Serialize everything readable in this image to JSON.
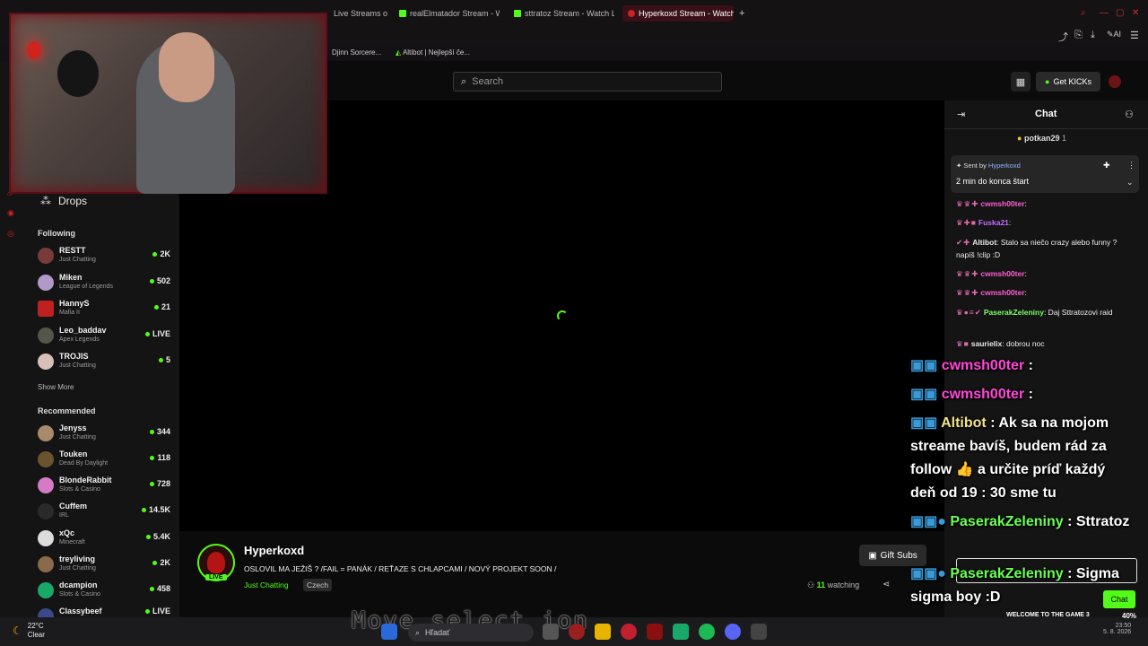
{
  "browser": {
    "tabs": [
      {
        "label": "Live Streams o"
      },
      {
        "label": "realElmatador Stream - W"
      },
      {
        "label": "sttratoz Stream - Watch Li"
      },
      {
        "label": "Hyperkoxd Stream - Watch"
      }
    ],
    "new_tab": "+",
    "toolbar_ai": "AI",
    "bookmarks": [
      "Djinn Sorcere...",
      "Altibot | Nejlepší če..."
    ]
  },
  "header": {
    "search_placeholder": "Search",
    "get_kicks": "Get KICKs"
  },
  "sidebar": {
    "drops_label": "Drops",
    "following_title": "Following",
    "following": [
      {
        "name": "RESTT",
        "category": "Just Chatting",
        "count": "2K"
      },
      {
        "name": "Miken",
        "category": "League of Legends",
        "count": "502"
      },
      {
        "name": "HannyS",
        "category": "Mafia II",
        "count": "21"
      },
      {
        "name": "Leo_baddav",
        "category": "Apex Legends",
        "count": "LIVE"
      },
      {
        "name": "TROJIS",
        "category": "Just Chatting",
        "count": "5"
      }
    ],
    "show_more": "Show More",
    "recommended_title": "Recommended",
    "recommended": [
      {
        "name": "Jenyss",
        "category": "Just Chatting",
        "count": "344"
      },
      {
        "name": "Touken",
        "category": "Dead By Daylight",
        "count": "118"
      },
      {
        "name": "BlondeRabbit",
        "category": "Slots & Casino",
        "count": "728"
      },
      {
        "name": "Cuffem",
        "category": "IRL",
        "count": "14.5K"
      },
      {
        "name": "xQc",
        "category": "Minecraft",
        "count": "5.4K"
      },
      {
        "name": "treyliving",
        "category": "Just Chatting",
        "count": "2K"
      },
      {
        "name": "dcampion",
        "category": "Slots & Casino",
        "count": "458"
      },
      {
        "name": "Classybeef",
        "category": "",
        "count": "LIVE"
      }
    ]
  },
  "stream": {
    "channel": "Hyperkoxd",
    "live_badge": "LIVE",
    "title": "OSLOVIL MA JEŽIŠ ? /FAIL = PANÁK / REŤAZE S CHLAPCAMI / NOVÝ PROJEKT SOON /",
    "category": "Just Chatting",
    "tag": "Czech",
    "watching_count": "11",
    "watching_label": "watching",
    "gift_subs": "Gift Subs"
  },
  "chat": {
    "title": "Chat",
    "top_gifter": "potkan29",
    "top_gifter_count": "1",
    "pinned_sent_by": "Sent by",
    "pinned_user": "Hyperkoxd",
    "pinned_message": "2 min do konca štart",
    "messages": [
      {
        "user": "cwmsh00ter",
        "text": ":"
      },
      {
        "user": "Fuska21",
        "text": ":"
      },
      {
        "user": "Altibot",
        "text": ": Stalo sa niečo crazy alebo funny ? napíš !clip :D"
      },
      {
        "user": "cwmsh00ter",
        "text": ":"
      },
      {
        "user": "cwmsh00ter",
        "text": ":"
      },
      {
        "user": "PaserakZeleniny",
        "text": ": Daj Sttratozovi raid"
      },
      {
        "user": "saurielix",
        "text": ": dobrou noc"
      }
    ],
    "send_label": "Chat"
  },
  "overlay": {
    "lines": [
      {
        "user": "cwmsh00ter",
        "text": " :"
      },
      {
        "user": "cwmsh00ter",
        "text": " :"
      },
      {
        "user": "Altibot",
        "text": " : Ak sa na mojom streame bavíš, budem rád za follow 👍 a určite príď každý deň od 19 : 30 sme tu"
      },
      {
        "user": "PaserakZeleniny",
        "text": " : Sttratoz"
      },
      {
        "user": "PaserakZeleniny",
        "text": " : Sigma sigma boy :D"
      }
    ]
  },
  "taskbar": {
    "temp": "22°C",
    "weather": "Clear",
    "search": "Hľadať",
    "overlay_text": "Move select ion",
    "welcome": "WELCOME TO THE GAME 3",
    "battery": "40%",
    "time": "23:50",
    "date": "5. 8. 2026"
  }
}
